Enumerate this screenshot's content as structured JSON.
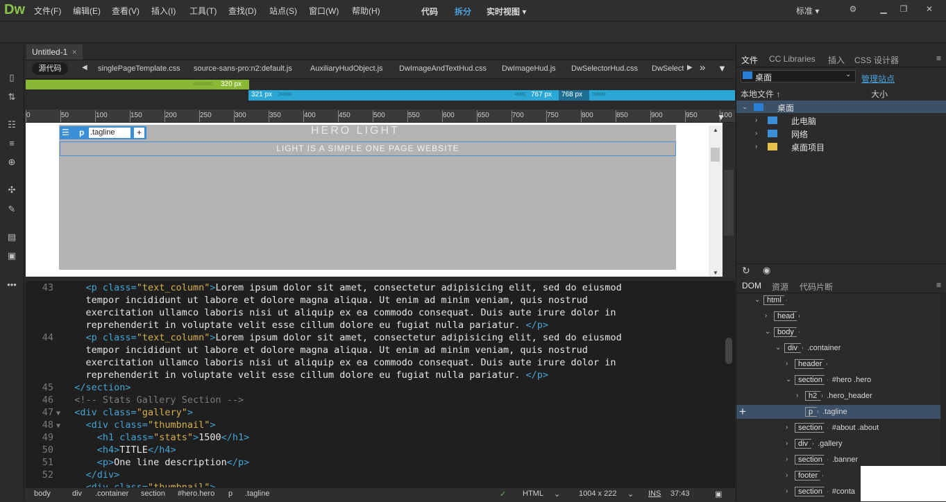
{
  "app": {
    "logo": "Dw",
    "workspace": "标准 ▾"
  },
  "menu": [
    "文件(F)",
    "编辑(E)",
    "查看(V)",
    "插入(I)",
    "工具(T)",
    "查找(D)",
    "站点(S)",
    "窗口(W)",
    "帮助(H)"
  ],
  "view_modes": {
    "code": "代码",
    "split": "拆分",
    "live": "实时视图 ▾"
  },
  "document": {
    "tab": "Untitled-1",
    "close": "×",
    "source_button": "源代码",
    "related_files": [
      "singlePageTemplate.css",
      "source-sans-pro:n2:default.js",
      "AuxiliaryHudObject.js",
      "DwImageAndTextHud.css",
      "DwImageHud.js",
      "DwSelectorHud.css",
      "DwSelect"
    ]
  },
  "media_queries": {
    "q1": "320  px",
    "q2_start": "321  px",
    "q2_a": "767  px",
    "q2_b": "768  px"
  },
  "ruler_ticks": [
    "0",
    "50",
    "100",
    "150",
    "200",
    "250",
    "300",
    "350",
    "400",
    "450",
    "500",
    "550",
    "600",
    "650",
    "700",
    "750",
    "800",
    "850",
    "900",
    "950",
    "100"
  ],
  "live": {
    "hero_title": "HERO LIGHT",
    "tagline": "LIGHT IS A SIMPLE ONE PAGE WEBSITE",
    "hud": {
      "tag": "p",
      "class": ".tagline",
      "plus": "+"
    }
  },
  "code_lines": [
    {
      "num": "43",
      "fold": "",
      "indent": "    ",
      "parts": [
        [
          "tag",
          "<p "
        ],
        [
          "attr",
          "class="
        ],
        [
          "str",
          "\"text_column\""
        ],
        [
          "tag",
          ">"
        ],
        [
          "txt",
          "Lorem ipsum dolor sit amet, consectetur adipisicing elit, sed do eiusmod"
        ]
      ]
    },
    {
      "num": "",
      "fold": "",
      "indent": "    ",
      "parts": [
        [
          "txt",
          "tempor incididunt ut labore et dolore magna aliqua. Ut enim ad minim veniam, quis nostrud"
        ]
      ]
    },
    {
      "num": "",
      "fold": "",
      "indent": "    ",
      "parts": [
        [
          "txt",
          "exercitation ullamco laboris nisi ut aliquip ex ea commodo consequat. Duis aute irure dolor in"
        ]
      ]
    },
    {
      "num": "",
      "fold": "",
      "indent": "    ",
      "parts": [
        [
          "txt",
          "reprehenderit in voluptate velit esse cillum dolore eu fugiat nulla pariatur. "
        ],
        [
          "tag",
          "</p>"
        ]
      ]
    },
    {
      "num": "44",
      "fold": "",
      "indent": "    ",
      "parts": [
        [
          "tag",
          "<p "
        ],
        [
          "attr",
          "class="
        ],
        [
          "str",
          "\"text_column\""
        ],
        [
          "tag",
          ">"
        ],
        [
          "txt",
          "Lorem ipsum dolor sit amet, consectetur adipisicing elit, sed do eiusmod"
        ]
      ]
    },
    {
      "num": "",
      "fold": "",
      "indent": "    ",
      "parts": [
        [
          "txt",
          "tempor incididunt ut labore et dolore magna aliqua. Ut enim ad minim veniam, quis nostrud"
        ]
      ]
    },
    {
      "num": "",
      "fold": "",
      "indent": "    ",
      "parts": [
        [
          "txt",
          "exercitation ullamco laboris nisi ut aliquip ex ea commodo consequat. Duis aute irure dolor in"
        ]
      ]
    },
    {
      "num": "",
      "fold": "",
      "indent": "    ",
      "parts": [
        [
          "txt",
          "reprehenderit in voluptate velit esse cillum dolore eu fugiat nulla pariatur. "
        ],
        [
          "tag",
          "</p>"
        ]
      ]
    },
    {
      "num": "45",
      "fold": "",
      "indent": "  ",
      "parts": [
        [
          "tag",
          "</section>"
        ]
      ]
    },
    {
      "num": "46",
      "fold": "",
      "indent": "  ",
      "parts": [
        [
          "cmt",
          "<!-- Stats Gallery Section -->"
        ]
      ]
    },
    {
      "num": "47",
      "fold": "▼",
      "indent": "  ",
      "parts": [
        [
          "tag",
          "<div "
        ],
        [
          "attr",
          "class="
        ],
        [
          "str",
          "\"gallery\""
        ],
        [
          "tag",
          ">"
        ]
      ]
    },
    {
      "num": "48",
      "fold": "▼",
      "indent": "    ",
      "parts": [
        [
          "tag",
          "<div "
        ],
        [
          "attr",
          "class="
        ],
        [
          "str",
          "\"thumbnail\""
        ],
        [
          "tag",
          ">"
        ]
      ]
    },
    {
      "num": "49",
      "fold": "",
      "indent": "      ",
      "parts": [
        [
          "tag",
          "<h1 "
        ],
        [
          "attr",
          "class="
        ],
        [
          "str",
          "\"stats\""
        ],
        [
          "tag",
          ">"
        ],
        [
          "txt",
          "1500"
        ],
        [
          "tag",
          "</h1>"
        ]
      ]
    },
    {
      "num": "50",
      "fold": "",
      "indent": "      ",
      "parts": [
        [
          "tag",
          "<h4>"
        ],
        [
          "txt",
          "TITLE"
        ],
        [
          "tag",
          "</h4>"
        ]
      ]
    },
    {
      "num": "51",
      "fold": "",
      "indent": "      ",
      "parts": [
        [
          "tag",
          "<p>"
        ],
        [
          "txt",
          "One line description"
        ],
        [
          "tag",
          "</p>"
        ]
      ]
    },
    {
      "num": "52",
      "fold": "",
      "indent": "    ",
      "parts": [
        [
          "tag",
          "</div>"
        ]
      ]
    },
    {
      "num": "",
      "fold": "",
      "indent": "    ",
      "parts": [
        [
          "tag",
          "<div "
        ],
        [
          "attr",
          "class="
        ],
        [
          "str",
          "\"thumbnail\""
        ],
        [
          "tag",
          ">"
        ]
      ]
    }
  ],
  "status": {
    "breadcrumbs": [
      "body",
      "div",
      ".container",
      "section",
      "#hero.hero",
      "p",
      ".tagline"
    ],
    "language": "HTML",
    "size": "1004 x 222",
    "ins": "INS",
    "position": "37:43"
  },
  "files_panel": {
    "tabs": [
      "文件",
      "CC Libraries",
      "插入",
      "CSS 设计器"
    ],
    "site": "桌面",
    "manage": "管理站点",
    "col_local": "本地文件 ↑",
    "col_size": "大小",
    "tree": [
      {
        "label": "桌面",
        "level": 0,
        "expanded": true
      },
      {
        "label": "此电脑",
        "level": 1
      },
      {
        "label": "网络",
        "level": 1
      },
      {
        "label": "桌面项目",
        "level": 1
      }
    ]
  },
  "dom_panel": {
    "tabs": [
      "DOM",
      "资源",
      "代码片断"
    ],
    "nodes": [
      {
        "tag": "html",
        "label": "",
        "level": 0,
        "arrow": "v"
      },
      {
        "tag": "head",
        "label": "",
        "level": 1,
        "arrow": ">"
      },
      {
        "tag": "body",
        "label": "",
        "level": 1,
        "arrow": "v"
      },
      {
        "tag": "div",
        "label": ".container",
        "level": 2,
        "arrow": "v"
      },
      {
        "tag": "header",
        "label": "",
        "level": 3,
        "arrow": ">"
      },
      {
        "tag": "section",
        "label": "#hero .hero",
        "level": 3,
        "arrow": "v"
      },
      {
        "tag": "h2",
        "label": ".hero_header",
        "level": 4,
        "arrow": ">"
      },
      {
        "tag": "p",
        "label": ".tagline",
        "level": 4,
        "arrow": ""
      },
      {
        "tag": "section",
        "label": "#about .about",
        "level": 3,
        "arrow": ">"
      },
      {
        "tag": "div",
        "label": ".gallery",
        "level": 3,
        "arrow": ">"
      },
      {
        "tag": "section",
        "label": ".banner",
        "level": 3,
        "arrow": ">"
      },
      {
        "tag": "footer",
        "label": "",
        "level": 3,
        "arrow": ">"
      },
      {
        "tag": "section",
        "label": "#conta",
        "level": 3,
        "arrow": ">"
      }
    ],
    "add": "+"
  }
}
